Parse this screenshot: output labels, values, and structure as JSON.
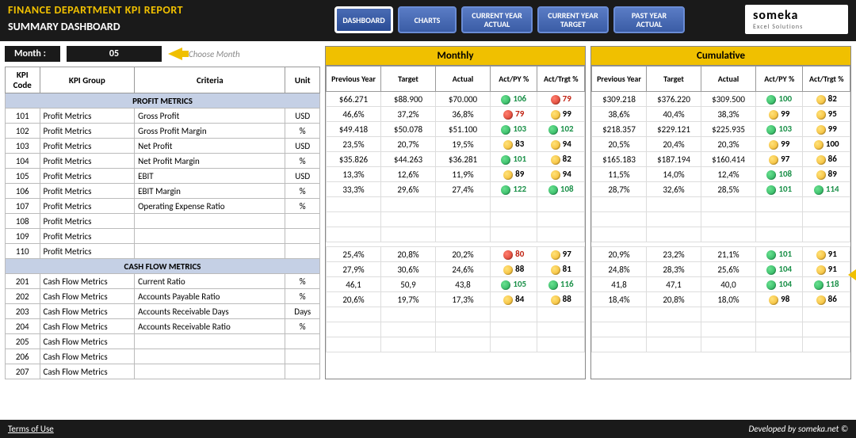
{
  "header": {
    "title1": "FINANCE DEPARTMENT KPI REPORT",
    "title2": "SUMMARY DASHBOARD",
    "tabs": [
      "DASHBOARD",
      "CHARTS",
      "CURRENT YEAR ACTUAL",
      "CURRENT YEAR TARGET",
      "PAST YEAR ACTUAL"
    ],
    "logo1": "someka",
    "logo2": "Excel Solutions"
  },
  "month": {
    "label": "Month :",
    "value": "05",
    "hint": "Choose Month"
  },
  "leftCols": {
    "code": "KPI Code",
    "group": "KPI Group",
    "crit": "Criteria",
    "unit": "Unit"
  },
  "groups": {
    "profit": "PROFIT METRICS",
    "cash": "CASH FLOW METRICS"
  },
  "rows": [
    {
      "code": "101",
      "group": "Profit Metrics",
      "crit": "Gross Profit",
      "unit": "USD"
    },
    {
      "code": "102",
      "group": "Profit Metrics",
      "crit": "Gross Profit Margin",
      "unit": "%"
    },
    {
      "code": "103",
      "group": "Profit Metrics",
      "crit": "Net Profit",
      "unit": "USD"
    },
    {
      "code": "104",
      "group": "Profit Metrics",
      "crit": "Net Profit Margin",
      "unit": "%"
    },
    {
      "code": "105",
      "group": "Profit Metrics",
      "crit": "EBIT",
      "unit": "USD"
    },
    {
      "code": "106",
      "group": "Profit Metrics",
      "crit": "EBIT Margin",
      "unit": "%"
    },
    {
      "code": "107",
      "group": "Profit Metrics",
      "crit": "Operating Expense Ratio",
      "unit": "%"
    },
    {
      "code": "108",
      "group": "Profit Metrics",
      "crit": "",
      "unit": ""
    },
    {
      "code": "109",
      "group": "Profit Metrics",
      "crit": "",
      "unit": ""
    },
    {
      "code": "110",
      "group": "Profit Metrics",
      "crit": "",
      "unit": ""
    }
  ],
  "rows2": [
    {
      "code": "201",
      "group": "Cash Flow Metrics",
      "crit": "Current Ratio",
      "unit": "%"
    },
    {
      "code": "202",
      "group": "Cash Flow Metrics",
      "crit": "Accounts Payable Ratio",
      "unit": "%"
    },
    {
      "code": "203",
      "group": "Cash Flow Metrics",
      "crit": "Accounts Receivable Days",
      "unit": "Days"
    },
    {
      "code": "204",
      "group": "Cash Flow Metrics",
      "crit": "Accounts Receivable Ratio",
      "unit": "%"
    },
    {
      "code": "205",
      "group": "Cash Flow Metrics",
      "crit": "",
      "unit": ""
    },
    {
      "code": "206",
      "group": "Cash Flow Metrics",
      "crit": "",
      "unit": ""
    },
    {
      "code": "207",
      "group": "Cash Flow Metrics",
      "crit": "",
      "unit": ""
    }
  ],
  "panelCols": {
    "prev": "Previous Year",
    "target": "Target",
    "actual": "Actual",
    "apy": "Act/PY %",
    "atg": "Act/Trgt %"
  },
  "panels": [
    {
      "title": "Monthly",
      "data": [
        {
          "p": "$66.271",
          "t": "$88.900",
          "a": "$70.000",
          "py": "106",
          "pyC": "G",
          "tg": "79",
          "tgC": "R"
        },
        {
          "p": "46,6%",
          "t": "37,2%",
          "a": "36,8%",
          "py": "79",
          "pyC": "R",
          "tg": "99",
          "tgC": "Y"
        },
        {
          "p": "$49.418",
          "t": "$50.078",
          "a": "$51.100",
          "py": "103",
          "pyC": "G",
          "tg": "102",
          "tgC": "G"
        },
        {
          "p": "23,5%",
          "t": "20,7%",
          "a": "19,5%",
          "py": "83",
          "pyC": "Y",
          "tg": "94",
          "tgC": "Y"
        },
        {
          "p": "$35.826",
          "t": "$44.263",
          "a": "$36.281",
          "py": "101",
          "pyC": "G",
          "tg": "82",
          "tgC": "Y"
        },
        {
          "p": "13,3%",
          "t": "12,6%",
          "a": "11,9%",
          "py": "89",
          "pyC": "Y",
          "tg": "94",
          "tgC": "Y"
        },
        {
          "p": "33,3%",
          "t": "29,6%",
          "a": "27,4%",
          "py": "122",
          "pyC": "G",
          "tg": "108",
          "tgC": "G"
        },
        null,
        null,
        null
      ],
      "data2": [
        {
          "p": "25,4%",
          "t": "20,8%",
          "a": "20,2%",
          "py": "80",
          "pyC": "R",
          "tg": "97",
          "tgC": "Y"
        },
        {
          "p": "27,9%",
          "t": "30,6%",
          "a": "24,6%",
          "py": "88",
          "pyC": "Y",
          "tg": "81",
          "tgC": "Y"
        },
        {
          "p": "46,1",
          "t": "50,9",
          "a": "43,8",
          "py": "105",
          "pyC": "G",
          "tg": "116",
          "tgC": "G"
        },
        {
          "p": "20,6%",
          "t": "19,7%",
          "a": "17,3%",
          "py": "84",
          "pyC": "Y",
          "tg": "88",
          "tgC": "Y"
        },
        null,
        null,
        null
      ]
    },
    {
      "title": "Cumulative",
      "data": [
        {
          "p": "$309.218",
          "t": "$376.220",
          "a": "$309.500",
          "py": "100",
          "pyC": "G",
          "tg": "82",
          "tgC": "Y"
        },
        {
          "p": "38,6%",
          "t": "40,4%",
          "a": "38,3%",
          "py": "99",
          "pyC": "Y",
          "tg": "95",
          "tgC": "Y"
        },
        {
          "p": "$218.357",
          "t": "$229.121",
          "a": "$225.935",
          "py": "103",
          "pyC": "G",
          "tg": "99",
          "tgC": "Y"
        },
        {
          "p": "20,5%",
          "t": "20,4%",
          "a": "20,3%",
          "py": "99",
          "pyC": "Y",
          "tg": "100",
          "tgC": "Y"
        },
        {
          "p": "$165.183",
          "t": "$187.194",
          "a": "$160.414",
          "py": "97",
          "pyC": "Y",
          "tg": "86",
          "tgC": "Y"
        },
        {
          "p": "11,5%",
          "t": "14,0%",
          "a": "12,4%",
          "py": "108",
          "pyC": "G",
          "tg": "89",
          "tgC": "Y"
        },
        {
          "p": "28,7%",
          "t": "32,6%",
          "a": "28,5%",
          "py": "101",
          "pyC": "G",
          "tg": "114",
          "tgC": "G"
        },
        null,
        null,
        null
      ],
      "data2": [
        {
          "p": "20,9%",
          "t": "23,2%",
          "a": "21,1%",
          "py": "101",
          "pyC": "G",
          "tg": "91",
          "tgC": "Y"
        },
        {
          "p": "24,8%",
          "t": "28,3%",
          "a": "25,6%",
          "py": "104",
          "pyC": "G",
          "tg": "91",
          "tgC": "Y"
        },
        {
          "p": "41,8",
          "t": "47,1",
          "a": "40,0",
          "py": "104",
          "pyC": "G",
          "tg": "118",
          "tgC": "G"
        },
        {
          "p": "18,4%",
          "t": "20,8%",
          "a": "18,0%",
          "py": "98",
          "pyC": "Y",
          "tg": "86",
          "tgC": "Y"
        },
        null,
        null,
        null
      ]
    }
  ],
  "footer": {
    "terms": "Terms of Use",
    "dev": "Developed by someka.net ©"
  }
}
